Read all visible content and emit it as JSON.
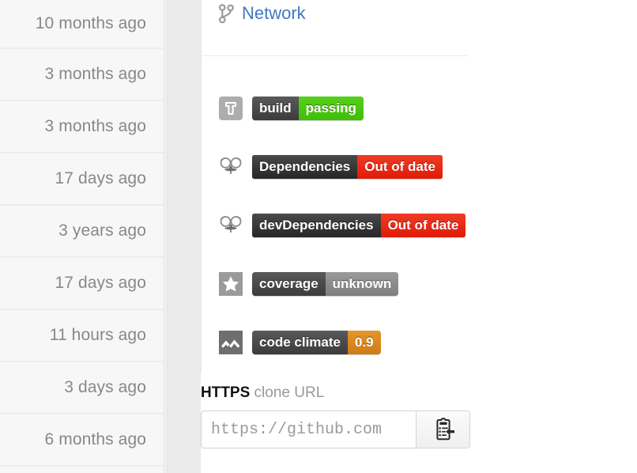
{
  "commit_ages": {
    "rows": [
      {
        "text": "10 months ago"
      },
      {
        "text": "3 months ago"
      },
      {
        "text": "3 months ago"
      },
      {
        "text": "17 days ago"
      },
      {
        "text": "3 years ago"
      },
      {
        "text": "17 days ago"
      },
      {
        "text": "11 hours ago"
      },
      {
        "text": "3 days ago"
      },
      {
        "text": "6 months ago"
      }
    ]
  },
  "network": {
    "icon": "network-icon",
    "label": "Network",
    "link_color": "#4078c0"
  },
  "badges": [
    {
      "icon": "travis-ci-icon",
      "label": "build",
      "value": "passing",
      "value_color": "#4bc81a",
      "label_color": "#464646"
    },
    {
      "icon": "david-dm-glasses-icon",
      "label": "Dependencies",
      "value": "Out of date",
      "value_color": "#e8230f",
      "label_color": "#333333"
    },
    {
      "icon": "david-dm-glasses-icon",
      "label": "devDependencies",
      "value": "Out of date",
      "value_color": "#e8230f",
      "label_color": "#333333"
    },
    {
      "icon": "coveralls-star-icon",
      "label": "coverage",
      "value": "unknown",
      "value_color": "#8c8c8c",
      "label_color": "#464646"
    },
    {
      "icon": "code-climate-icon",
      "label": "code climate",
      "value": "0.9",
      "value_color": "#d9861f",
      "label_color": "#464646"
    }
  ],
  "clone": {
    "protocol": "HTTPS",
    "title_suffix": " clone URL",
    "url_value": "https://github.com",
    "copy_icon": "clipboard-copy-icon"
  }
}
